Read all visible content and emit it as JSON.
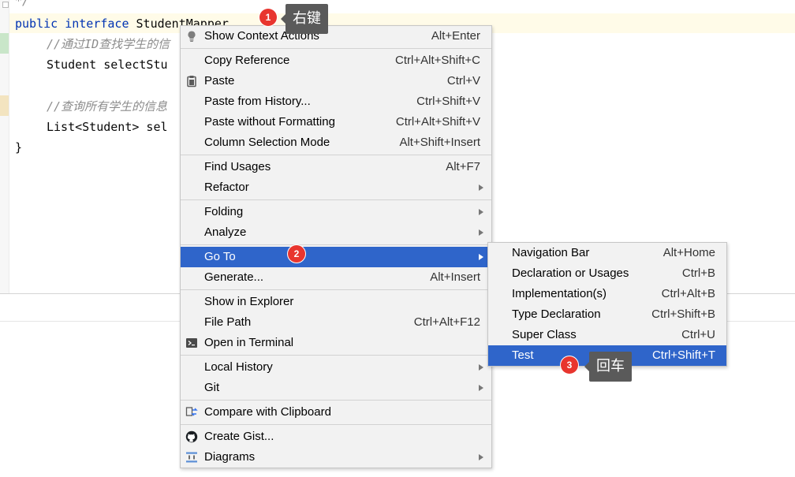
{
  "editor": {
    "comment_top": "*/",
    "line1_kw1": "public",
    "line1_kw2": "interface",
    "line1_class": "StudentMapper",
    "comment1": "//通过ID查找学生的信",
    "line2": "Student selectStu",
    "comment2": "//查询所有学生的信息",
    "line3": "List<Student> sel",
    "closing": "}"
  },
  "main_menu": {
    "items": [
      {
        "label": "Show Context Actions",
        "shortcut": "Alt+Enter",
        "icon": "bulb-icon"
      },
      {
        "label": "Copy Reference",
        "shortcut": "Ctrl+Alt+Shift+C"
      },
      {
        "label": "Paste",
        "shortcut": "Ctrl+V",
        "icon": "clipboard-icon"
      },
      {
        "label": "Paste from History...",
        "shortcut": "Ctrl+Shift+V"
      },
      {
        "label": "Paste without Formatting",
        "shortcut": "Ctrl+Alt+Shift+V"
      },
      {
        "label": "Column Selection Mode",
        "shortcut": "Alt+Shift+Insert"
      },
      {
        "label": "Find Usages",
        "shortcut": "Alt+F7"
      },
      {
        "label": "Refactor",
        "shortcut": ""
      },
      {
        "label": "Folding",
        "shortcut": ""
      },
      {
        "label": "Analyze",
        "shortcut": ""
      },
      {
        "label": "Go To",
        "shortcut": ""
      },
      {
        "label": "Generate...",
        "shortcut": "Alt+Insert"
      },
      {
        "label": "Show in Explorer",
        "shortcut": ""
      },
      {
        "label": "File Path",
        "shortcut": "Ctrl+Alt+F12"
      },
      {
        "label": "Open in Terminal",
        "shortcut": "",
        "icon": "terminal-icon"
      },
      {
        "label": "Local History",
        "shortcut": ""
      },
      {
        "label": "Git",
        "shortcut": ""
      },
      {
        "label": "Compare with Clipboard",
        "shortcut": "",
        "icon": "compare-icon"
      },
      {
        "label": "Create Gist...",
        "shortcut": "",
        "icon": "github-icon"
      },
      {
        "label": "Diagrams",
        "shortcut": "",
        "icon": "diagram-icon"
      }
    ]
  },
  "sub_menu": {
    "items": [
      {
        "label": "Navigation Bar",
        "shortcut": "Alt+Home"
      },
      {
        "label": "Declaration or Usages",
        "shortcut": "Ctrl+B"
      },
      {
        "label": "Implementation(s)",
        "shortcut": "Ctrl+Alt+B"
      },
      {
        "label": "Type Declaration",
        "shortcut": "Ctrl+Shift+B"
      },
      {
        "label": "Super Class",
        "shortcut": "Ctrl+U"
      },
      {
        "label": "Test",
        "shortcut": "Ctrl+Shift+T"
      }
    ]
  },
  "annotations": {
    "step1_num": "1",
    "step1_text": "右键",
    "step2_num": "2",
    "step3_num": "3",
    "step3_text": "回车"
  },
  "colors": {
    "selection": "#2f65ca",
    "badge": "#e8352e",
    "tooltip": "#5a5a5a",
    "keyword": "#0033b3"
  }
}
